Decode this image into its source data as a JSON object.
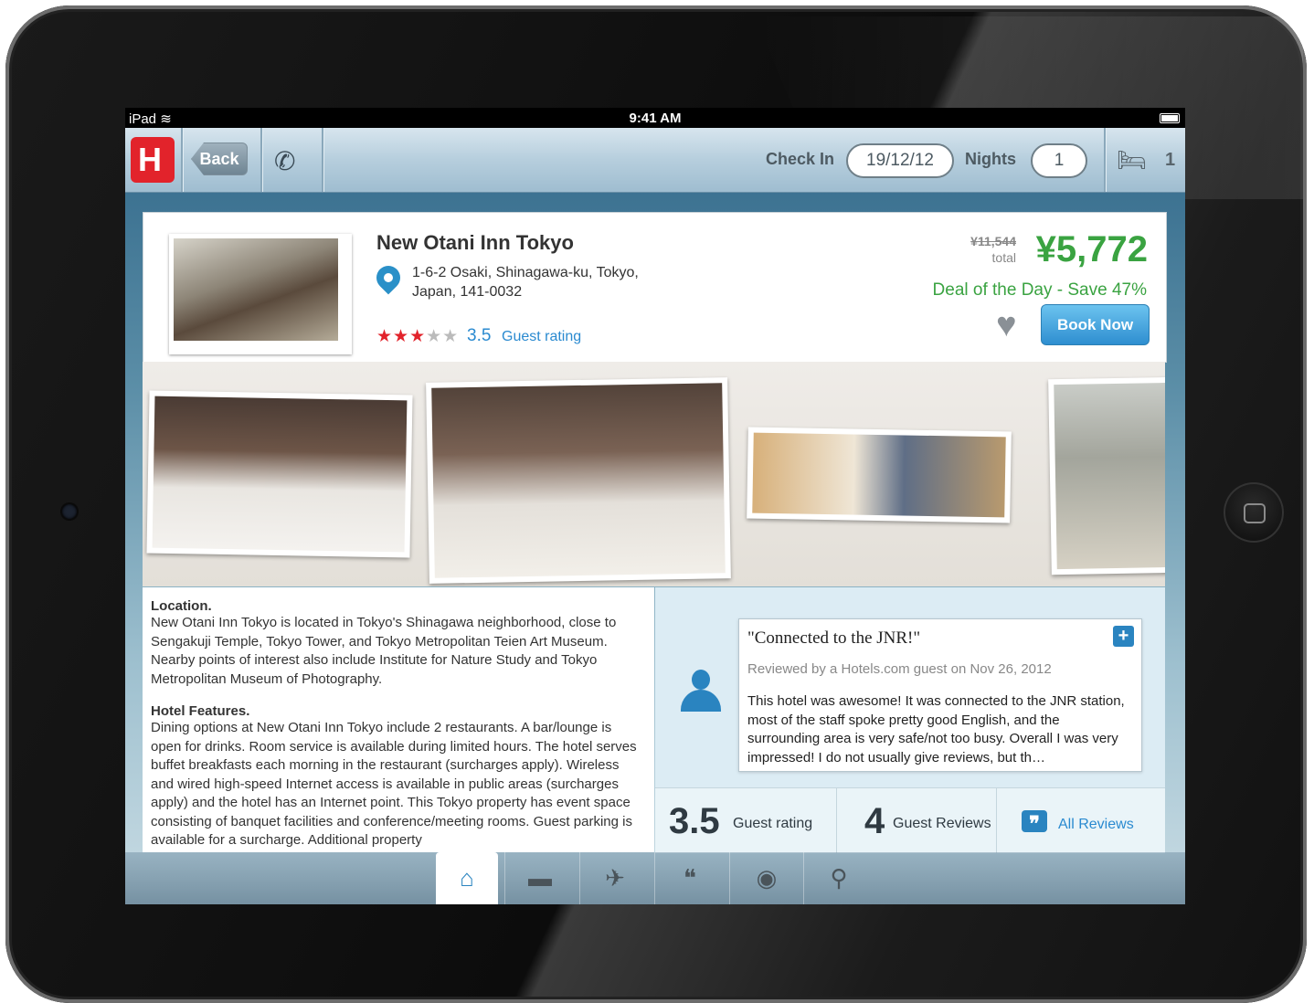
{
  "status_bar": {
    "device": "iPad",
    "wifi_icon": "wifi-icon",
    "time": "9:41 AM",
    "battery_icon": "battery-icon"
  },
  "toolbar": {
    "logo_letter": "H",
    "back_label": "Back",
    "phone_icon": "phone-icon",
    "checkin_label": "Check In",
    "checkin_value": "19/12/12",
    "nights_label": "Nights",
    "nights_value": "1",
    "rooms_icon": "bed-icon",
    "rooms_value": "1"
  },
  "hotel": {
    "name": "New Otani Inn Tokyo",
    "address_line1": "1-6-2 Osaki, Shinagawa-ku, Tokyo,",
    "address_line2": "Japan, 141-0032",
    "stars": 3,
    "stars_max": 5,
    "rating": "3.5",
    "rating_label": "Guest rating",
    "old_price": "¥11,544",
    "total_label": "total",
    "price": "¥5,772",
    "deal": "Deal of the Day - Save 47%",
    "book_label": "Book Now"
  },
  "description": {
    "location_heading": "Location.",
    "location_text": "New Otani Inn Tokyo is located in Tokyo's Shinagawa neighborhood, close to Sengakuji Temple, Tokyo Tower, and Tokyo Metropolitan Teien Art Museum. Nearby points of interest also include Institute for Nature Study and Tokyo Metropolitan Museum of Photography.",
    "features_heading": "Hotel Features.",
    "features_text": "Dining options at New Otani Inn Tokyo include 2 restaurants. A bar/lounge is open for drinks. Room service is available during limited hours. The hotel serves buffet breakfasts each morning in the restaurant (surcharges apply). Wireless and wired high-speed Internet access is available in public areas (surcharges apply) and the hotel has an Internet point. This Tokyo property has event space consisting of banquet facilities and conference/meeting rooms. Guest parking is available for a surcharge. Additional property"
  },
  "review": {
    "title": "\"Connected to the JNR!\"",
    "reviewed_by": "Reviewed by a Hotels.com guest on Nov 26, 2012",
    "text": "This hotel was awesome! It was connected to the JNR station, most of the staff spoke pretty good English, and the surrounding area is very safe/not too busy. Overall I was very impressed! I do not usually give reviews, but th…",
    "expand_label": "+"
  },
  "stats": {
    "rating": "3.5",
    "rating_label": "Guest rating",
    "reviews_count": "4",
    "reviews_label": "Guest Reviews",
    "all_reviews_label": "All Reviews"
  },
  "tabs": [
    {
      "name": "home",
      "icon": "⌂"
    },
    {
      "name": "rooms",
      "icon": "▬"
    },
    {
      "name": "amenities",
      "icon": "✈"
    },
    {
      "name": "reviews",
      "icon": "❝"
    },
    {
      "name": "photos",
      "icon": "◉"
    },
    {
      "name": "map",
      "icon": "⚲"
    }
  ],
  "colors": {
    "price_green": "#3aa341",
    "link_blue": "#2a8ad0",
    "brand_red": "#e2232b"
  }
}
